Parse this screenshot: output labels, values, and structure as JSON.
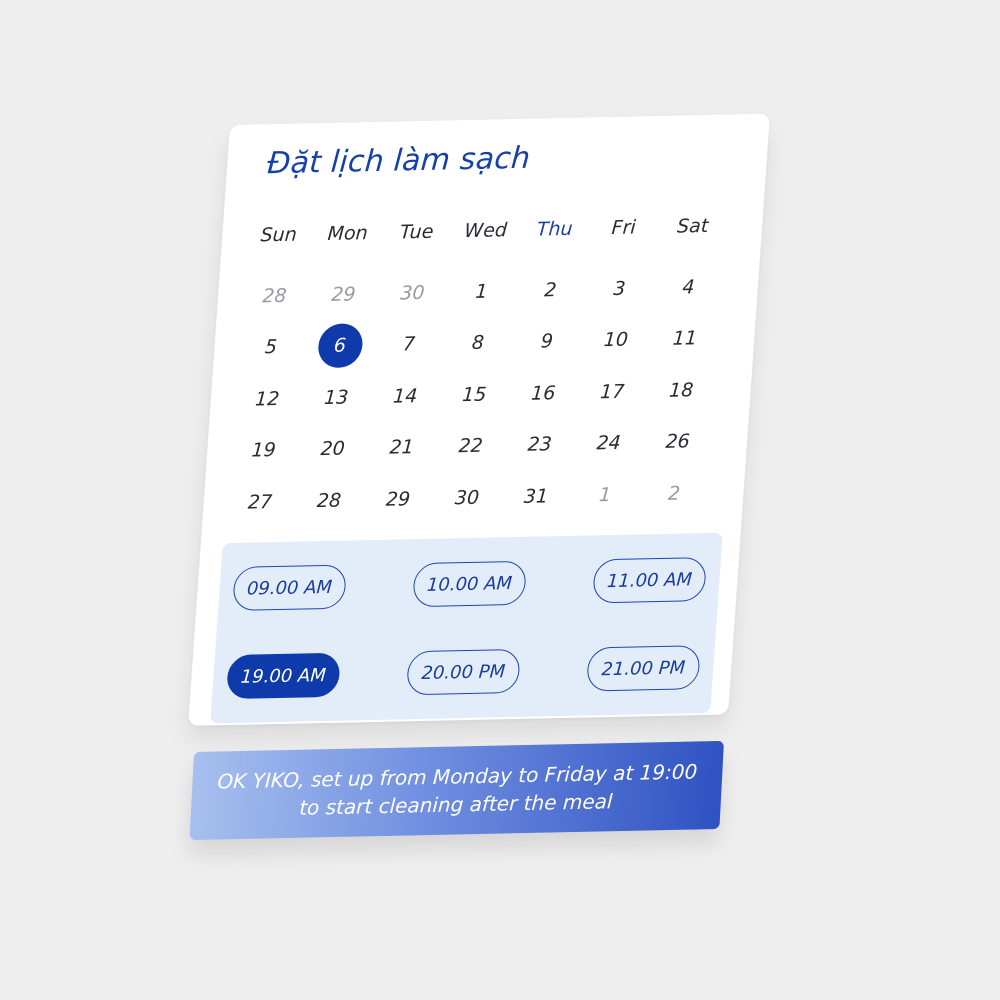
{
  "calendar": {
    "title": "Đặt lịch làm sạch",
    "weekdays": [
      {
        "label": "Sun",
        "highlight": false
      },
      {
        "label": "Mon",
        "highlight": false
      },
      {
        "label": "Tue",
        "highlight": false
      },
      {
        "label": "Wed",
        "highlight": false
      },
      {
        "label": "Thu",
        "highlight": true
      },
      {
        "label": "Fri",
        "highlight": false
      },
      {
        "label": "Sat",
        "highlight": false
      }
    ],
    "days": [
      {
        "label": "28",
        "muted": true
      },
      {
        "label": "29",
        "muted": true
      },
      {
        "label": "30",
        "muted": true
      },
      {
        "label": "1"
      },
      {
        "label": "2"
      },
      {
        "label": "3"
      },
      {
        "label": "4"
      },
      {
        "label": "5"
      },
      {
        "label": "6",
        "selected": true
      },
      {
        "label": "7"
      },
      {
        "label": "8"
      },
      {
        "label": "9"
      },
      {
        "label": "10"
      },
      {
        "label": "11"
      },
      {
        "label": "12"
      },
      {
        "label": "13"
      },
      {
        "label": "14"
      },
      {
        "label": "15"
      },
      {
        "label": "16"
      },
      {
        "label": "17"
      },
      {
        "label": "18"
      },
      {
        "label": "19"
      },
      {
        "label": "20"
      },
      {
        "label": "21"
      },
      {
        "label": "22"
      },
      {
        "label": "23"
      },
      {
        "label": "24"
      },
      {
        "label": "26"
      },
      {
        "label": "27"
      },
      {
        "label": "28"
      },
      {
        "label": "29"
      },
      {
        "label": "30"
      },
      {
        "label": "31"
      },
      {
        "label": "1",
        "muted": true
      },
      {
        "label": "2",
        "muted": true
      }
    ]
  },
  "time_slots": [
    {
      "label": "09.00 AM",
      "active": false
    },
    {
      "label": "10.00 AM",
      "active": false
    },
    {
      "label": "11.00 AM",
      "active": false
    },
    {
      "label": "19.00 AM",
      "active": true
    },
    {
      "label": "20.00 PM",
      "active": false
    },
    {
      "label": "21.00 PM",
      "active": false
    }
  ],
  "voice_command": {
    "line1": "OK YIKO, set up from Monday to Friday at 19:00",
    "line2": "to start cleaning after the meal"
  },
  "colors": {
    "accent": "#0f3aab",
    "background": "#eeeeef",
    "slot_panel": "#e3edf9"
  }
}
